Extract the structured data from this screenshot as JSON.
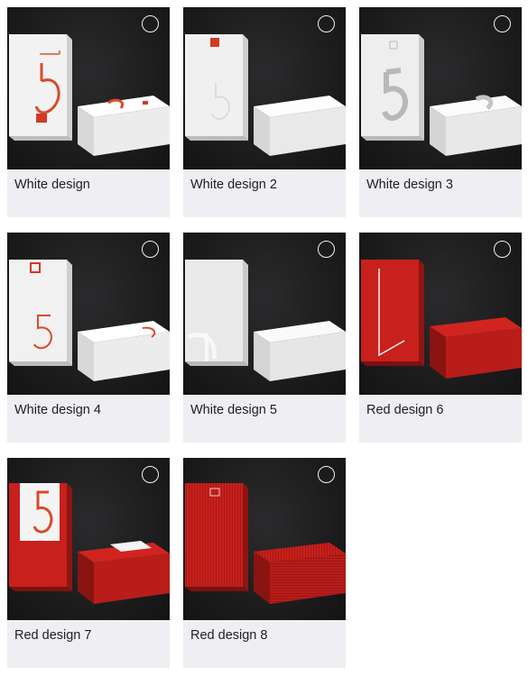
{
  "options": [
    {
      "label": "White design",
      "theme": "white",
      "mark": "5-red-arc",
      "selected": false
    },
    {
      "label": "White design 2",
      "theme": "white",
      "mark": "5-emboss",
      "selected": false
    },
    {
      "label": "White design 3",
      "theme": "white",
      "mark": "5-silver",
      "selected": false
    },
    {
      "label": "White design 4",
      "theme": "white",
      "mark": "5-red-thin",
      "selected": false
    },
    {
      "label": "White design 5",
      "theme": "white",
      "mark": "5-ghost",
      "selected": false
    },
    {
      "label": "Red design 6",
      "theme": "red",
      "mark": "white-line",
      "selected": false
    },
    {
      "label": "Red design 7",
      "theme": "red",
      "mark": "5-white-band",
      "selected": false
    },
    {
      "label": "Red design 8",
      "theme": "red",
      "mark": "stripes",
      "selected": false
    }
  ],
  "colors": {
    "thumb_bg": "#1c1c1d",
    "card_bg": "#efeff3",
    "white_box": "#f4f4f4",
    "red_box": "#c9201c",
    "accent": "#d33a22"
  }
}
